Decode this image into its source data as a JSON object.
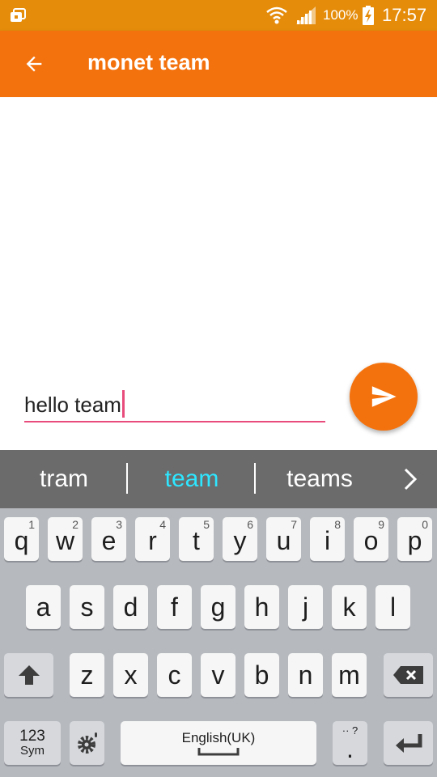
{
  "status_bar": {
    "battery_text": "100%",
    "time": "17:57",
    "icons": [
      "notification-icon",
      "wifi-icon",
      "signal-icon",
      "battery-charging-icon"
    ]
  },
  "app_bar": {
    "title": "monet team",
    "back_icon": "arrow-left-icon",
    "color": "#f4720e"
  },
  "composer": {
    "input_value": "hello team",
    "send_icon": "send-icon",
    "underline_color": "#e84c7c"
  },
  "suggestions": {
    "items": [
      "tram",
      "team",
      "teams"
    ],
    "active_index": 1,
    "more_icon": "chevron-right-icon"
  },
  "keyboard": {
    "row1": [
      {
        "k": "q",
        "n": "1"
      },
      {
        "k": "w",
        "n": "2"
      },
      {
        "k": "e",
        "n": "3"
      },
      {
        "k": "r",
        "n": "4"
      },
      {
        "k": "t",
        "n": "5"
      },
      {
        "k": "y",
        "n": "6"
      },
      {
        "k": "u",
        "n": "7"
      },
      {
        "k": "i",
        "n": "8"
      },
      {
        "k": "o",
        "n": "9"
      },
      {
        "k": "p",
        "n": "0"
      }
    ],
    "row2": [
      "a",
      "s",
      "d",
      "f",
      "g",
      "h",
      "j",
      "k",
      "l"
    ],
    "row3": [
      "z",
      "x",
      "c",
      "v",
      "b",
      "n",
      "m"
    ],
    "sym_label_top": "123",
    "sym_label_bottom": "Sym",
    "space_label": "English(UK)",
    "period_label": ".",
    "period_sub": "·· ?"
  }
}
